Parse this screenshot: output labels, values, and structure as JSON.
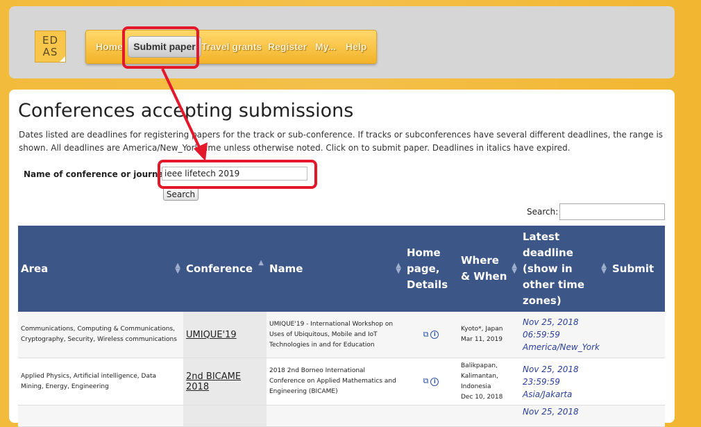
{
  "logo": {
    "line1": "ED",
    "line2": "AS"
  },
  "nav": {
    "home": "Home",
    "submit_paper": "Submit paper",
    "travel_grants": "Travel grants",
    "register": "Register",
    "my": "My...",
    "help": "Help"
  },
  "page": {
    "title": "Conferences accepting submissions",
    "description": "Dates listed are deadlines for registering papers for the track or sub-conference. If tracks or subconferences have several different deadlines, the range is shown. All deadlines are America/New_York time unless otherwise noted. Click on  to submit paper. Deadlines in italics have expired."
  },
  "filter": {
    "label": "Name of conference or journal",
    "value": "ieee lifetech 2019",
    "button": "Search"
  },
  "table_search": {
    "label": "Search:"
  },
  "table": {
    "headers": {
      "area": "Area",
      "conference": "Conference",
      "name": "Name",
      "home_line1": "Home",
      "home_line2": "page,",
      "home_line3": "Details",
      "where_line1": "Where",
      "where_line2": "& When",
      "deadline_line1": "Latest",
      "deadline_line2": "deadline",
      "deadline_line3": "(show in",
      "deadline_line4": "other time",
      "deadline_line5": "zones)",
      "submit": "Submit"
    },
    "rows": [
      {
        "area": "Communications, Computing & Communications, Cryptography, Security, Wireless communications",
        "conference": "UMIQUE'19",
        "name": "UMIQUE'19 - International Workshop on Uses of Ubiquitous, Mobile and IoT Technologies in and for Education",
        "where": "Kyoto*, Japan",
        "when": "Mar 11, 2019",
        "deadline_date": "Nov 25, 2018",
        "deadline_time": "06:59:59",
        "deadline_tz": "America/New_York"
      },
      {
        "area": "Applied Physics, Artificial intelligence, Data Mining, Energy, Engineering",
        "conference": "2nd BICAME 2018",
        "name": "2018 2nd Borneo International Conference on Applied Mathematics and Engineering (BICAME)",
        "where": "Balikpapan, Kalimantan, Indonesia",
        "when": "Dec 10, 2018",
        "deadline_date": "Nov 25, 2018",
        "deadline_time": "23:59:59 Asia/Jakarta",
        "deadline_tz": ""
      }
    ],
    "partial_row_deadline": "Nov 25, 2018"
  },
  "colors": {
    "header_bg": "#3c5687",
    "annotation": "#e3182a",
    "page_bg": "#f3bb3c",
    "deadline": "#2a3e9a"
  }
}
